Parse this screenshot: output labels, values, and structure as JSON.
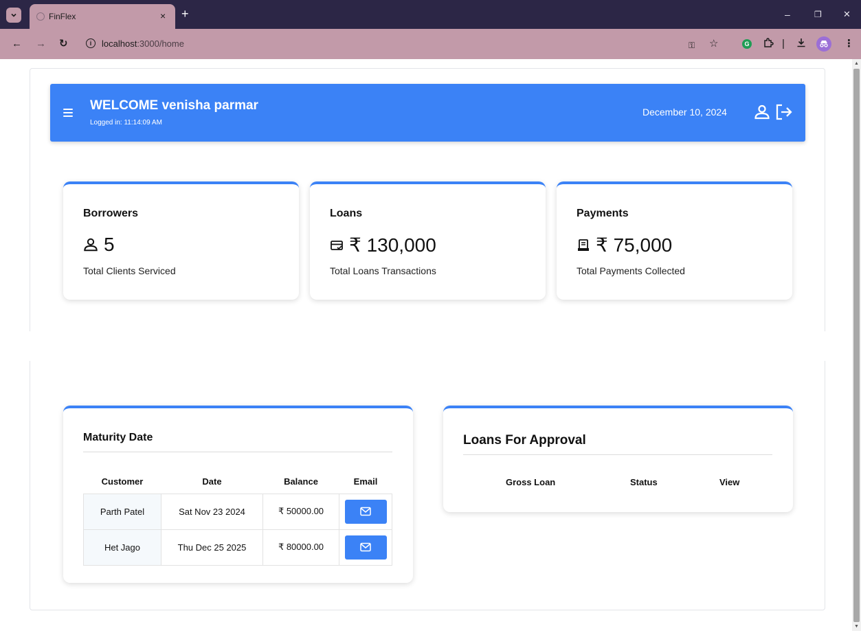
{
  "browser": {
    "tab_title": "FinFlex",
    "tab_close": "×",
    "new_tab": "+",
    "url_host": "localhost",
    "url_path": ":3000/home",
    "win_min": "–",
    "win_restore": "❐",
    "win_close": "✕"
  },
  "header": {
    "welcome": "WELCOME venisha parmar",
    "logged_in": "Logged in: 11:14:09 AM",
    "date": "December 10, 2024"
  },
  "stats": [
    {
      "title": "Borrowers",
      "value": "5",
      "subtitle": "Total Clients Serviced",
      "icon": "user-icon"
    },
    {
      "title": "Loans",
      "value": "₹ 130,000",
      "subtitle": "Total Loans Transactions",
      "icon": "card-icon"
    },
    {
      "title": "Payments",
      "value": "₹ 75,000",
      "subtitle": "Total Payments Collected",
      "icon": "receipt-icon"
    }
  ],
  "maturity": {
    "title": "Maturity Date",
    "columns": [
      "Customer",
      "Date",
      "Balance",
      "Email"
    ],
    "rows": [
      {
        "customer": "Parth Patel",
        "date": "Sat Nov 23 2024",
        "balance": "₹ 50000.00"
      },
      {
        "customer": "Het Jago",
        "date": "Thu Dec 25 2025",
        "balance": "₹ 80000.00"
      }
    ]
  },
  "approval": {
    "title": "Loans For Approval",
    "columns": [
      "Gross Loan",
      "Status",
      "View"
    ]
  },
  "colors": {
    "primary": "#3b82f6",
    "chrome_tabbar": "#2c2646",
    "chrome_toolbar": "#c29aa9"
  }
}
